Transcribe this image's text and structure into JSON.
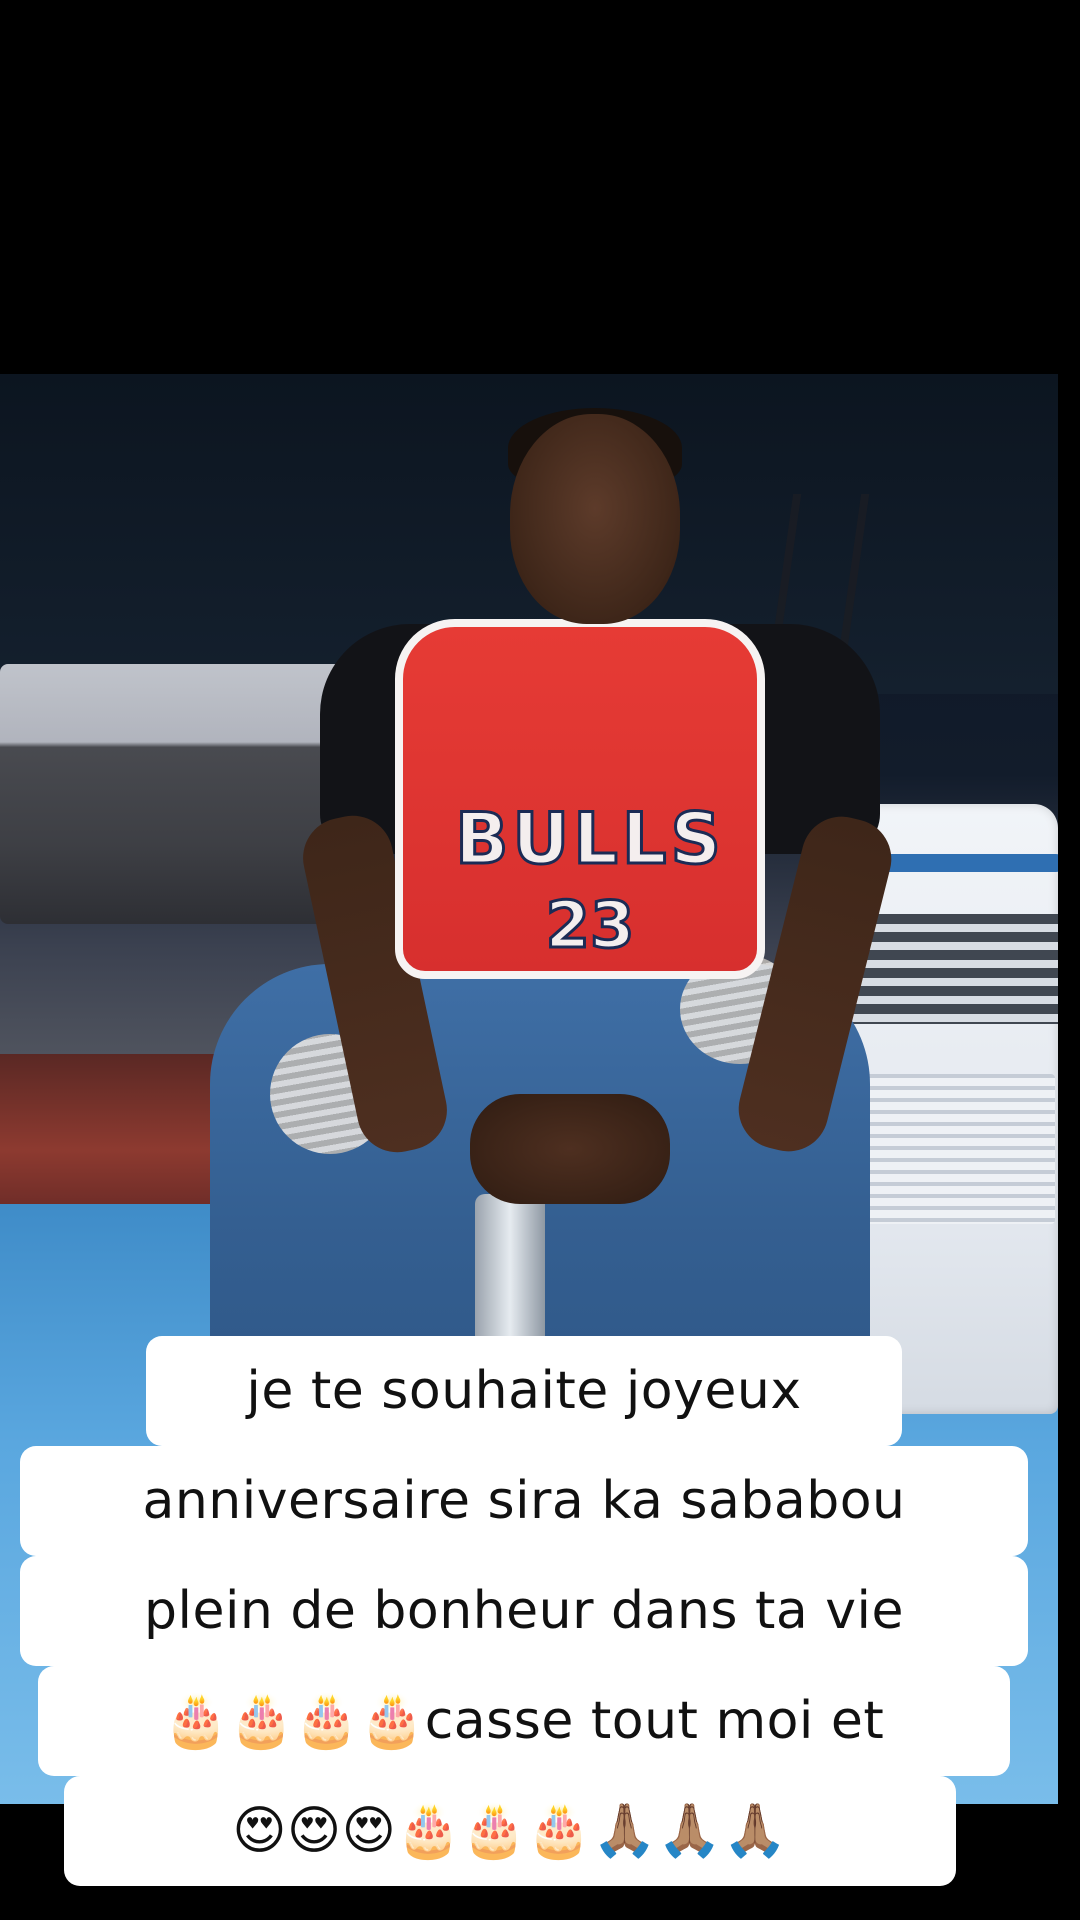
{
  "post": {
    "caption_lines": [
      "je te souhaite joyeux",
      "anniversaire sira ka sababou",
      "plein de bonheur dans ta vie",
      "🎂🎂🎂🎂casse tout moi et",
      "😍😍😍🎂🎂🎂🙏🏽🙏🏽🙏🏽"
    ]
  },
  "photo": {
    "jersey_team": "BULLS",
    "jersey_number": "23"
  },
  "colors": {
    "background": "#000000",
    "caption_bg": "#ffffff",
    "caption_text": "#111111",
    "jersey_red": "#e63b35"
  }
}
